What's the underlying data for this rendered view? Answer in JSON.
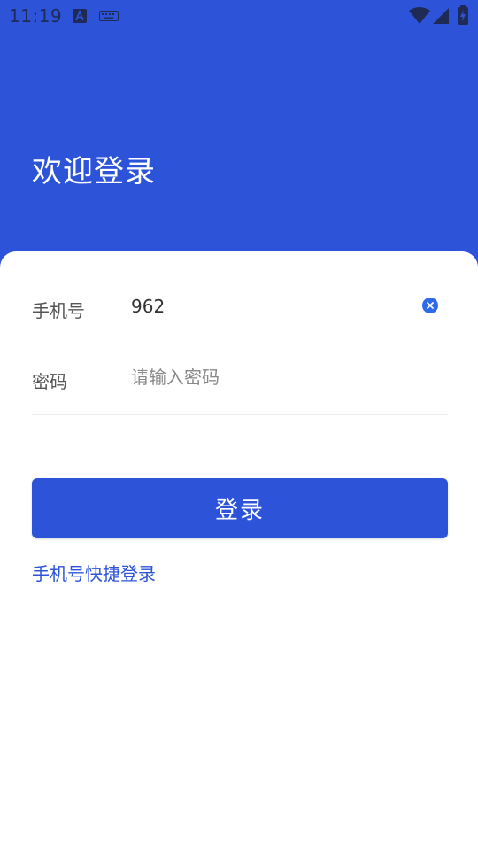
{
  "status_bar": {
    "time": "11:19",
    "icons": [
      "font-a-icon",
      "keyboard-icon",
      "wifi-icon",
      "cell-signal-icon",
      "battery-charging-icon"
    ]
  },
  "header": {
    "title": "欢迎登录"
  },
  "form": {
    "phone": {
      "label": "手机号",
      "value": "962",
      "placeholder": "",
      "clear_icon": "clear-circle-icon"
    },
    "password": {
      "label": "密码",
      "value": "",
      "placeholder": "请输入密码"
    }
  },
  "actions": {
    "login_label": "登录",
    "quick_login_label": "手机号快捷登录"
  },
  "colors": {
    "brand_blue": "#2d54d8",
    "clear_icon_blue": "#2f6be8",
    "background_white": "#ffffff"
  }
}
